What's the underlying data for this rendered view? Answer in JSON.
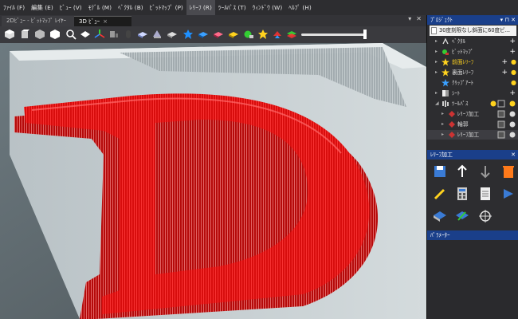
{
  "menu": [
    {
      "label": "ﾌｧｲﾙ (F)"
    },
    {
      "label": "編集 (E)"
    },
    {
      "label": "ﾋﾞｭｰ (V)"
    },
    {
      "label": "ﾓﾃﾞﾙ (M)"
    },
    {
      "label": "ﾍﾞｸﾀﾙ (B)"
    },
    {
      "label": "ﾋﾞｯﾄﾏｯﾌﾟ (P)"
    },
    {
      "label": "ﾚﾘｰﾌ (R)"
    },
    {
      "label": "ﾂｰﾙﾊﾟｽ (T)"
    },
    {
      "label": "ｳｨﾝﾄﾞｳ (W)"
    },
    {
      "label": "ﾍﾙﾌﾟ (H)"
    }
  ],
  "tabs": {
    "view2d": "2Dﾋﾞｭｰ - ﾋﾞｯﾄﾏｯﾌﾟ ﾚｲﾔｰ",
    "view3d": "3D ﾋﾞｭｰ",
    "close_glyph": "×"
  },
  "project": {
    "header": "ﾌﾟﾛｼﾞｪｸﾄ",
    "file": "30度刻限なし斜面に60度ビ...",
    "tree": [
      {
        "label": "ﾍﾞｸﾀﾙ",
        "icon": "vector-icon"
      },
      {
        "label": "ﾋﾞｯﾄﾏｯﾌﾟ",
        "icon": "bitmap-icon"
      },
      {
        "label": "前面ﾚﾘｰﾌ",
        "icon": "star-icon"
      },
      {
        "label": "裏面ﾚﾘｰﾌ",
        "icon": "star-icon"
      },
      {
        "label": "ｸﾘｯﾌﾟｱｰﾄ",
        "icon": "star-icon"
      },
      {
        "label": "ｼｰﾄ",
        "icon": "sheet-icon"
      },
      {
        "label": "ﾂｰﾙﾊﾟｽ",
        "icon": "toolpath-icon"
      },
      {
        "label": "ﾚﾘｰﾌ加工",
        "icon": "relief-machining-icon"
      },
      {
        "label": "輪郭",
        "icon": "profile-icon"
      },
      {
        "label": "ﾚﾘｰﾌ加工",
        "icon": "relief-machining-icon"
      }
    ]
  },
  "relief_panel": {
    "header": "ﾚﾘｰﾌ加工"
  },
  "params_panel": {
    "header": "ﾊﾟﾗﾒｰﾀｰ"
  },
  "view_letter": "D",
  "colors": {
    "relief_red": "#e01010",
    "panel_header": "#1a3f8a",
    "toolbar": "#3a3a3e",
    "menubar": "#2d2d30"
  }
}
